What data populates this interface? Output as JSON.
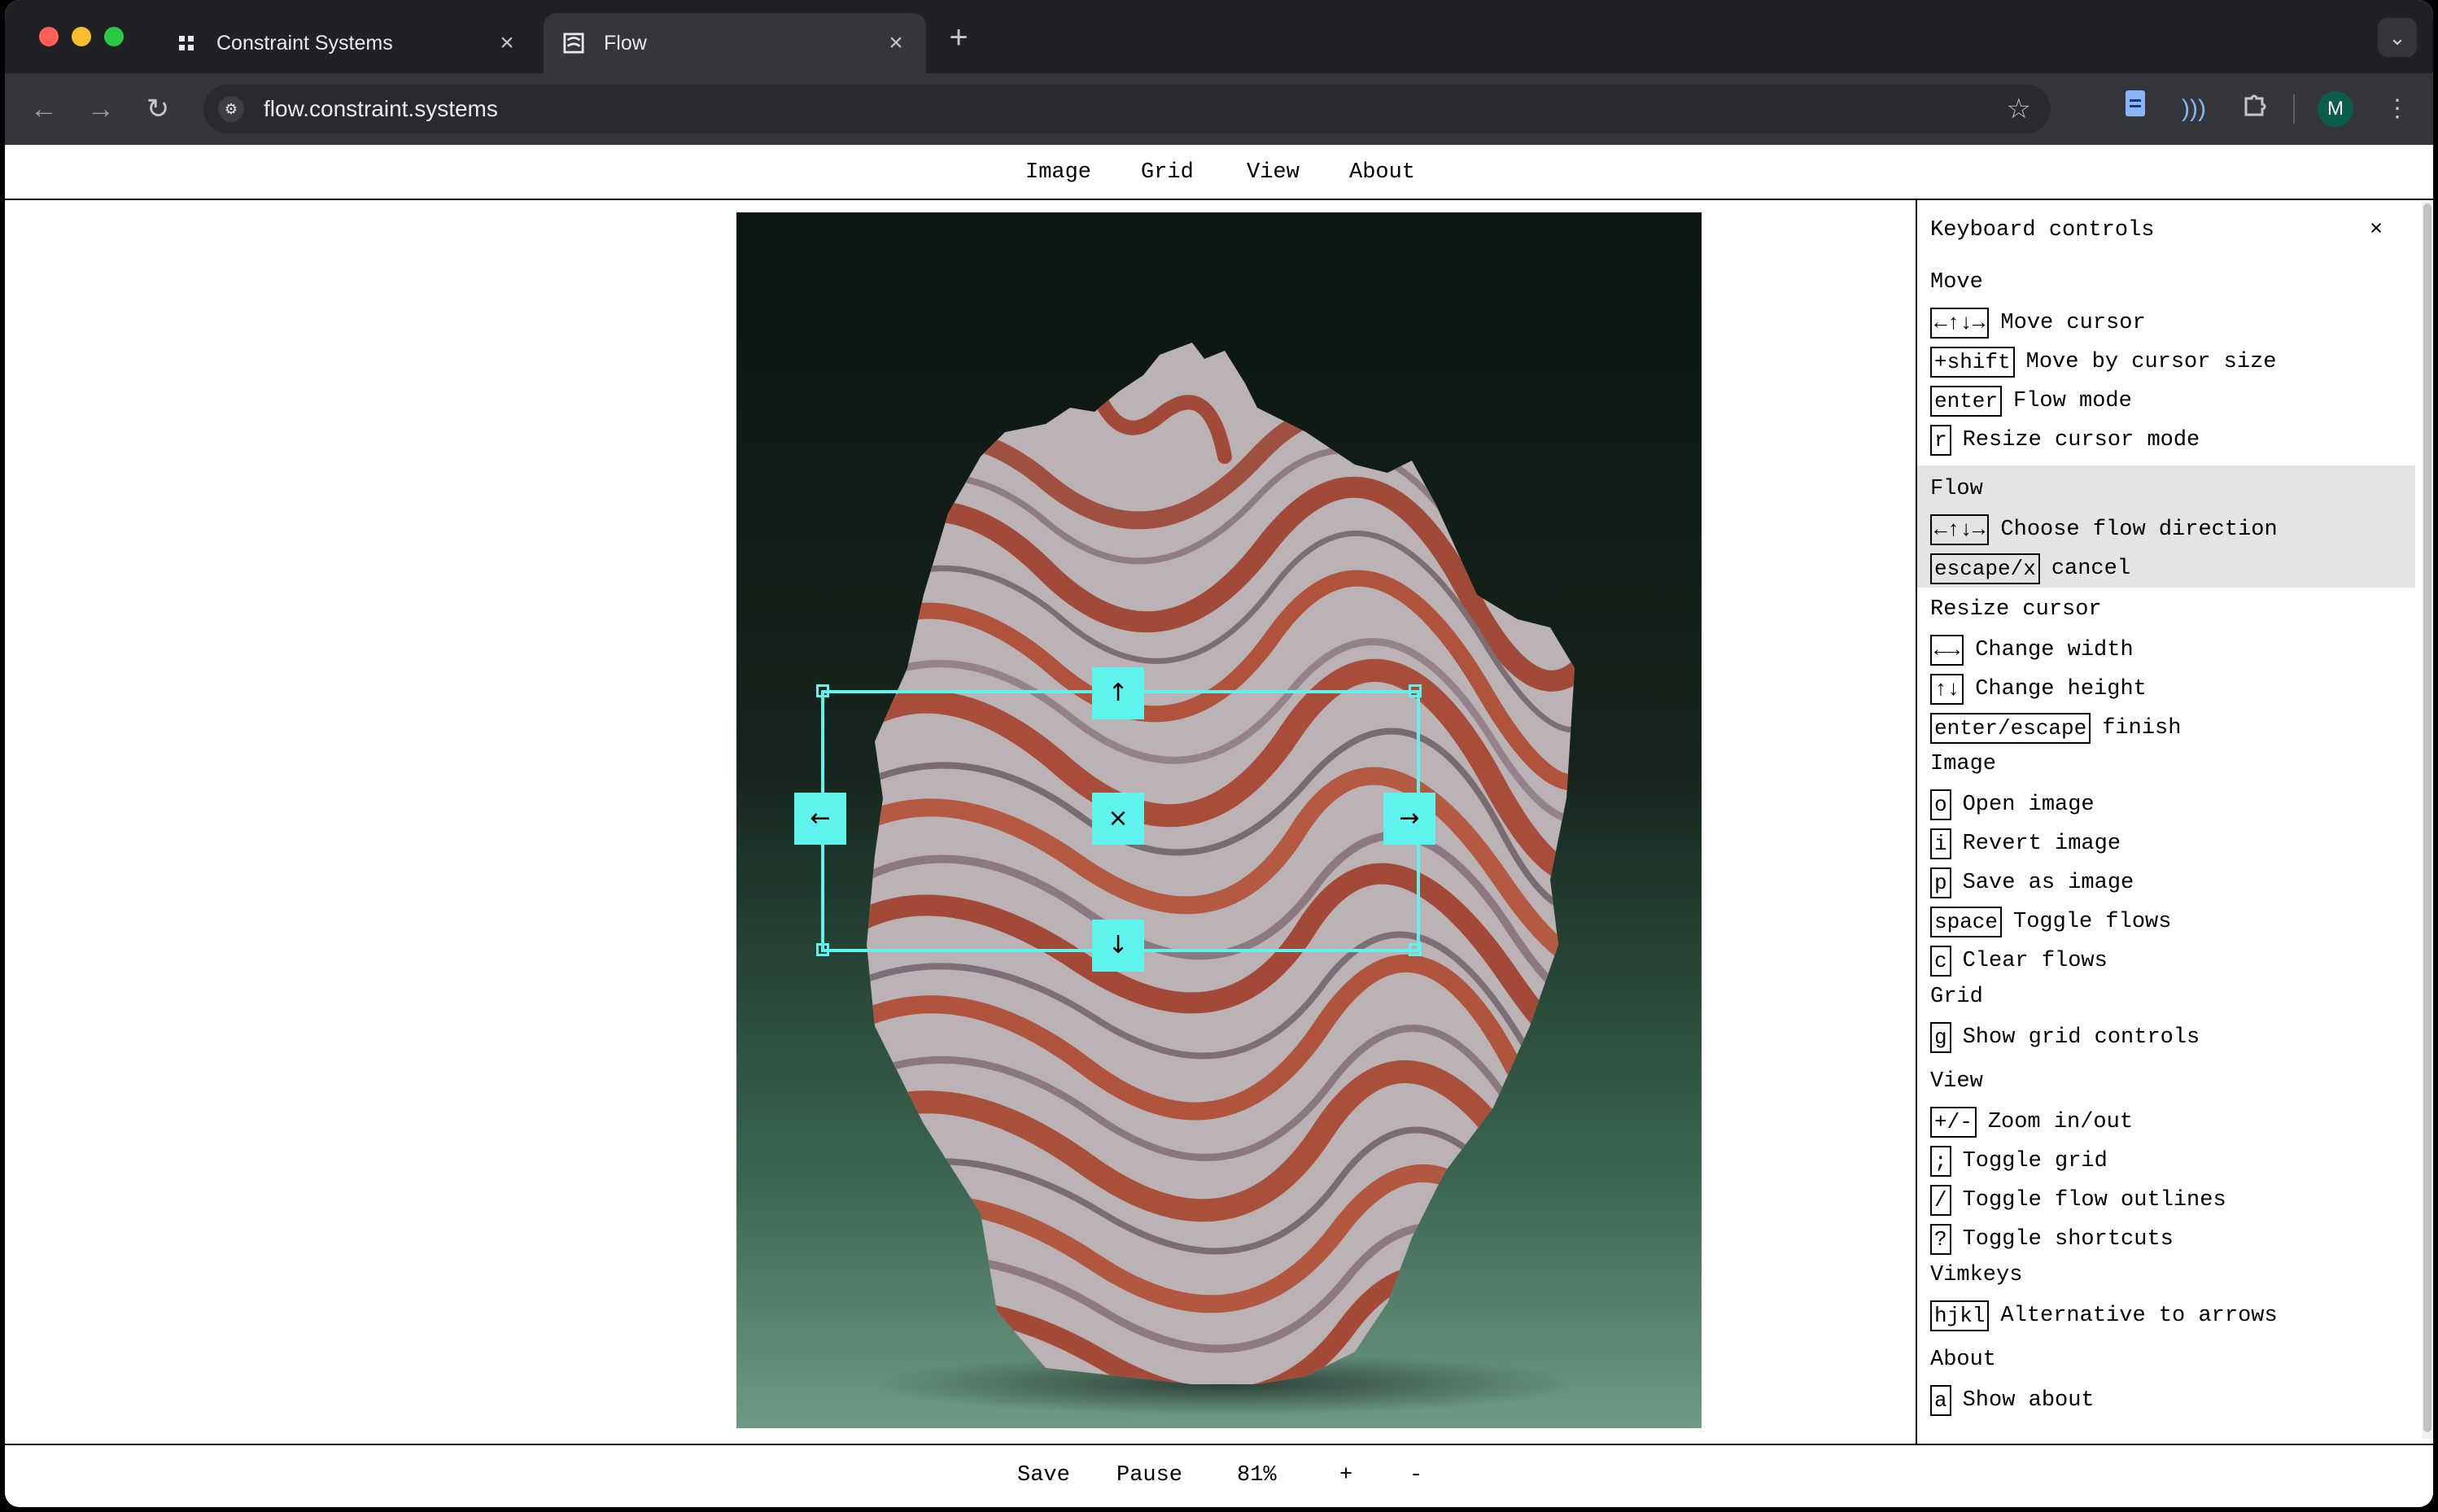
{
  "browser": {
    "tabs": [
      {
        "title": "Constraint Systems",
        "icon": "grid-icon"
      },
      {
        "title": "Flow",
        "icon": "flow-favicon-icon"
      }
    ],
    "url": "flow.constraint.systems",
    "profile_initial": "M",
    "colors": {
      "frame": "#202124",
      "toolbar": "#35363a",
      "omnibox": "#282a2d"
    }
  },
  "menu": {
    "image": "Image",
    "grid": "Grid",
    "view": "View",
    "about": "About"
  },
  "canvas": {
    "cursor_color": "#5ff3ee",
    "handles": {
      "up": "↑",
      "down": "↓",
      "left": "←",
      "right": "→",
      "center": "×"
    }
  },
  "panel": {
    "title": "Keyboard controls",
    "close": "×",
    "sections": [
      {
        "title": "Move",
        "rows": [
          {
            "key": "←↑↓→",
            "label": "Move cursor"
          },
          {
            "key": "+shift",
            "label": "Move by cursor size"
          },
          {
            "key": "enter",
            "label": "Flow mode"
          },
          {
            "key": "r",
            "label": "Resize cursor mode"
          }
        ]
      },
      {
        "title": "Flow",
        "rows": [
          {
            "key": "←↑↓→",
            "label": "Choose flow direction"
          },
          {
            "key": "escape/x",
            "label": "cancel"
          }
        ]
      },
      {
        "title": "Resize cursor",
        "rows": [
          {
            "key": "←→",
            "label": "Change width"
          },
          {
            "key": "↑↓",
            "label": "Change height"
          },
          {
            "key": "enter/escape",
            "label": "finish"
          }
        ]
      },
      {
        "title": "Image",
        "rows": [
          {
            "key": "o",
            "label": "Open image"
          },
          {
            "key": "i",
            "label": "Revert image"
          },
          {
            "key": "p",
            "label": "Save as image"
          },
          {
            "key": "space",
            "label": "Toggle flows"
          },
          {
            "key": "c",
            "label": "Clear flows"
          }
        ]
      },
      {
        "title": "Grid",
        "rows": [
          {
            "key": "g",
            "label": "Show grid controls"
          }
        ]
      },
      {
        "title": "View",
        "rows": [
          {
            "key": "+/-",
            "label": "Zoom in/out"
          },
          {
            "key": ";",
            "label": "Toggle grid"
          },
          {
            "key": "/",
            "label": "Toggle flow outlines"
          },
          {
            "key": "?",
            "label": "Toggle shortcuts"
          }
        ]
      },
      {
        "title": "Vimkeys",
        "rows": [
          {
            "key": "hjkl",
            "label": "Alternative to arrows"
          }
        ]
      },
      {
        "title": "About",
        "rows": [
          {
            "key": "a",
            "label": "Show about"
          }
        ]
      }
    ]
  },
  "footer": {
    "save": "Save",
    "pause": "Pause",
    "zoom": "81%",
    "zoom_in": "+",
    "zoom_out": "-"
  }
}
